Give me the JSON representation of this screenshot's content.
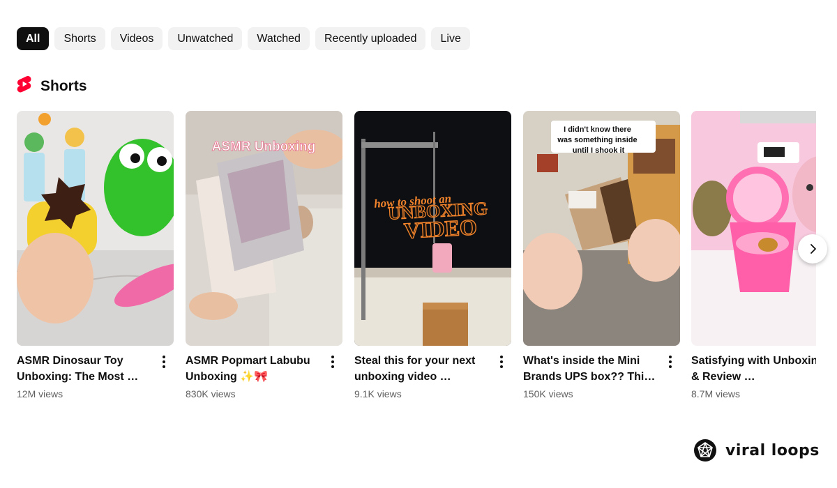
{
  "chips": [
    {
      "label": "All",
      "active": true
    },
    {
      "label": "Shorts",
      "active": false
    },
    {
      "label": "Videos",
      "active": false
    },
    {
      "label": "Unwatched",
      "active": false
    },
    {
      "label": "Watched",
      "active": false
    },
    {
      "label": "Recently uploaded",
      "active": false
    },
    {
      "label": "Live",
      "active": false
    }
  ],
  "shelf": {
    "title": "Shorts",
    "icon": "shorts-icon",
    "accent": "#ff0033"
  },
  "cards": [
    {
      "title": "ASMR Dinosaur Toy Unboxing: The Most …",
      "views": "12M views",
      "overlay": ""
    },
    {
      "title": "ASMR Popmart Labubu Unboxing ✨🎀‍‍",
      "views": "830K views",
      "overlay": "ASMR Unboxing"
    },
    {
      "title": "Steal this for your next unboxing video …",
      "views": "9.1K views",
      "overlay": "how to shoot an UNBOXING VIDEO"
    },
    {
      "title": "What's inside the Mini Brands UPS box?? Thi…",
      "views": "150K views",
      "overlay": "I didn't know there was something inside until I shook it"
    },
    {
      "title": "Satisfying with Unboxing & Review …",
      "views": "8.7M views",
      "overlay": ""
    }
  ],
  "brand": {
    "name": "viral loops",
    "icon": "viral-loops-logo"
  }
}
